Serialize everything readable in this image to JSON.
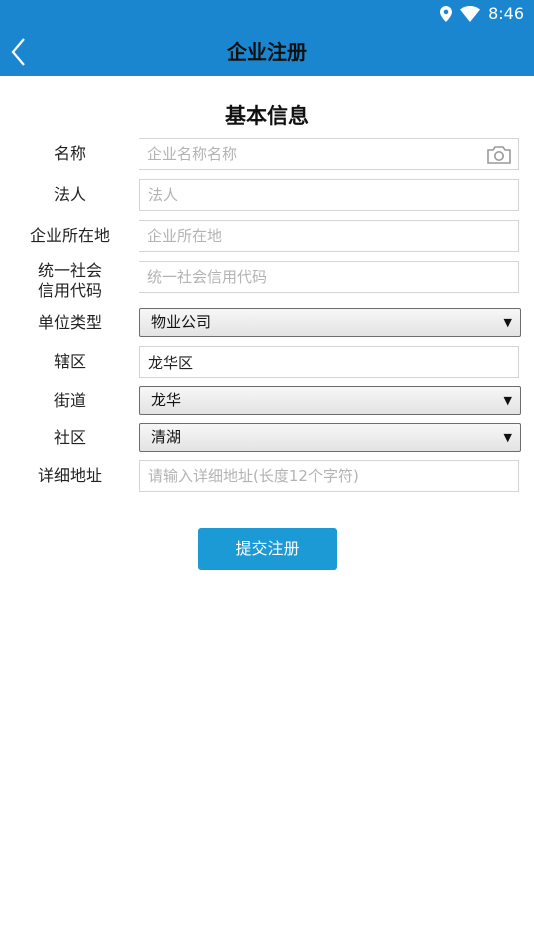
{
  "status_bar": {
    "time": "8:46"
  },
  "header": {
    "title": "企业注册"
  },
  "section": {
    "title": "基本信息"
  },
  "form": {
    "name": {
      "label": "名称",
      "placeholder": "企业名称名称"
    },
    "legal_person": {
      "label": "法人",
      "placeholder": "法人"
    },
    "location": {
      "label": "企业所在地",
      "placeholder": "企业所在地"
    },
    "credit_code": {
      "label_line1": "统一社会",
      "label_line2": "信用代码",
      "placeholder": "统一社会信用代码"
    },
    "unit_type": {
      "label": "单位类型",
      "value": "物业公司"
    },
    "district": {
      "label": "辖区",
      "value": "龙华区"
    },
    "street": {
      "label": "街道",
      "value": "龙华"
    },
    "community": {
      "label": "社区",
      "value": "清湖"
    },
    "address": {
      "label": "详细地址",
      "placeholder": "请输入详细地址(长度12个字符)"
    }
  },
  "submit": {
    "label": "提交注册"
  },
  "icons": {
    "back": "chevron-left-icon",
    "camera": "camera-icon",
    "location": "location-pin-icon",
    "wifi": "wifi-icon",
    "dropdown": "triangle-down-icon"
  },
  "colors": {
    "app_bar": "#1a86d0",
    "button": "#1b9ad6"
  }
}
